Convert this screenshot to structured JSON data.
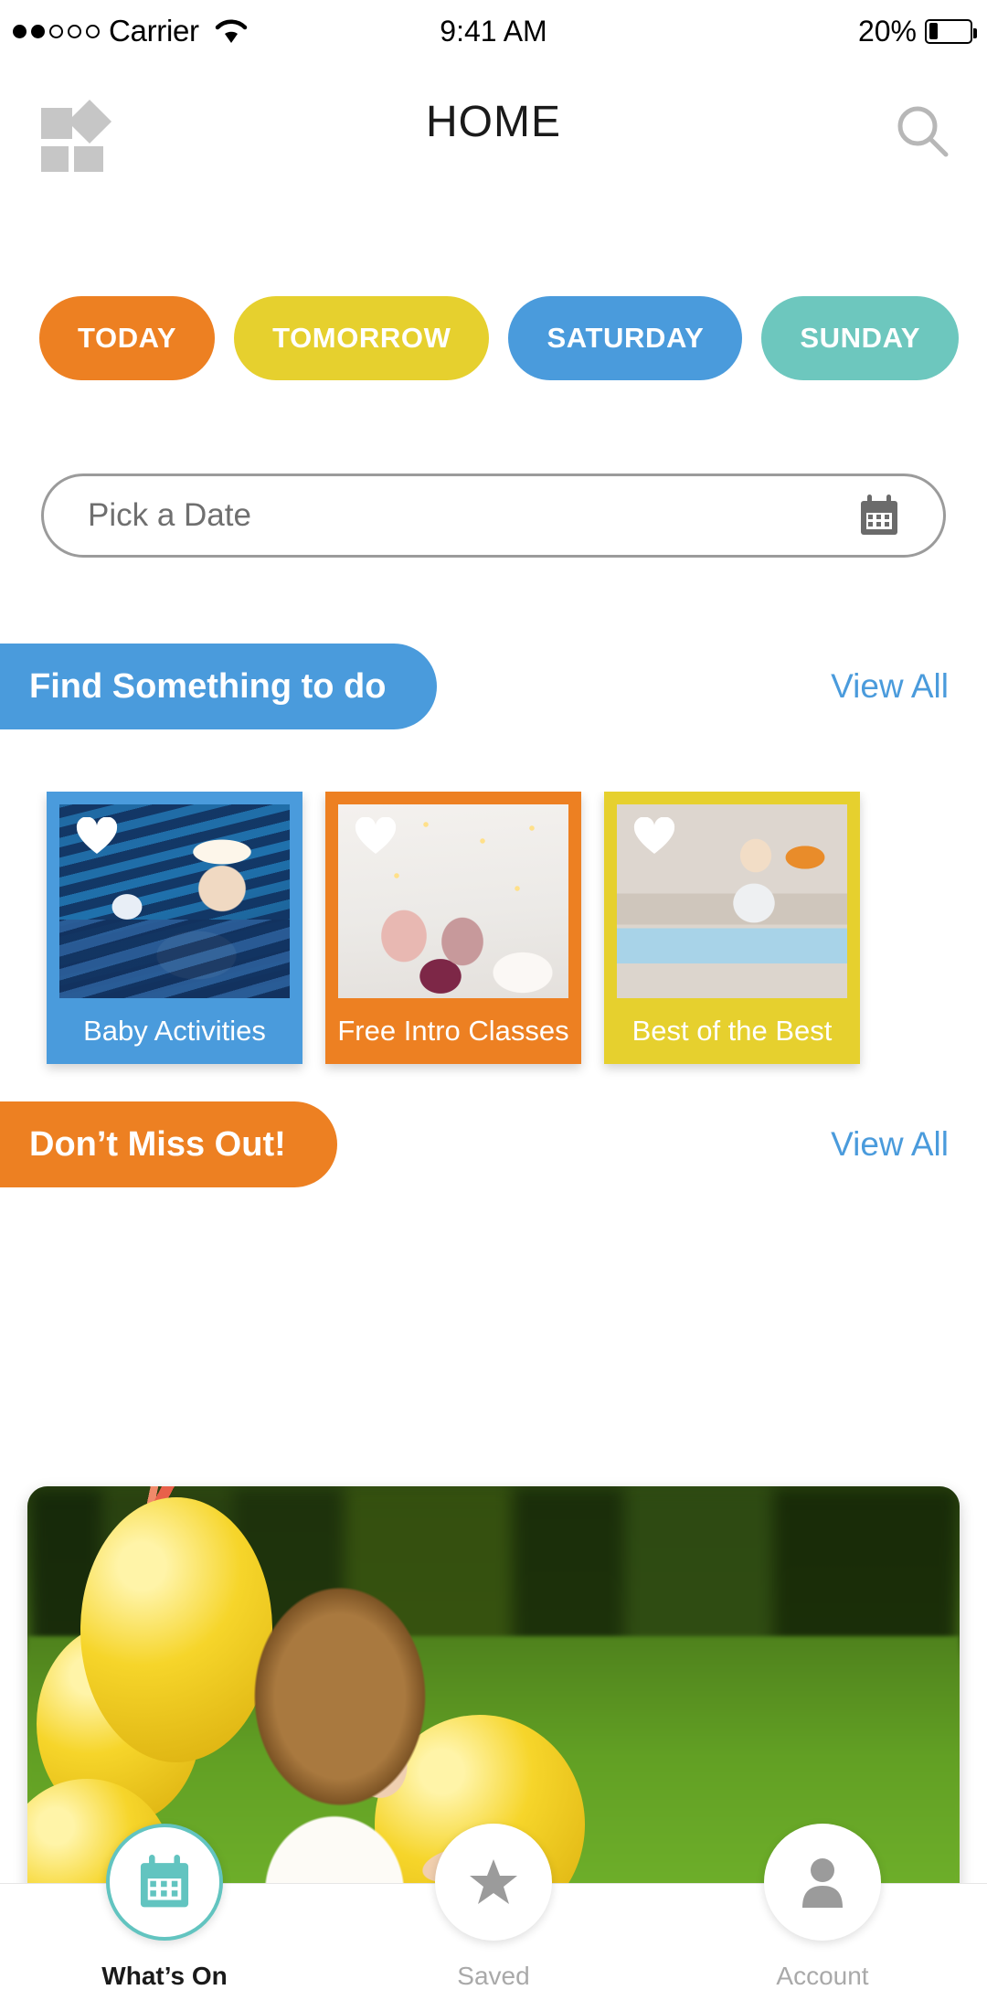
{
  "status_bar": {
    "carrier": "Carrier",
    "signal_filled": 2,
    "signal_total": 5,
    "wifi_icon": "wifi-icon",
    "time": "9:41 AM",
    "battery_percent": "20%",
    "battery_level": 20
  },
  "header": {
    "logo_icon": "blocks-logo-icon",
    "title": "HOME",
    "search_icon": "search-icon"
  },
  "day_chips": [
    {
      "label": "TODAY",
      "color": "#ED8022"
    },
    {
      "label": "TOMORROW",
      "color": "#E6D02E"
    },
    {
      "label": "SATURDAY",
      "color": "#4A9BDC"
    },
    {
      "label": "SUNDAY",
      "color": "#6DC7BE"
    }
  ],
  "date_picker": {
    "placeholder": "Pick a Date",
    "value": "",
    "calendar_icon": "calendar-icon"
  },
  "sections": [
    {
      "title": "Find Something to do",
      "pill_color": "#4A9BDC",
      "view_all_label": "View All",
      "view_all_color": "#4A9BDC"
    },
    {
      "title": "Don’t Miss Out!",
      "pill_color": "#ED8022",
      "view_all_label": "View All",
      "view_all_color": "#4A9BDC"
    }
  ],
  "category_cards": [
    {
      "label": "Baby Activities",
      "color": "#4A9BDC",
      "favorite_icon": "heart-icon",
      "photo": "baby-in-blue-hammock"
    },
    {
      "label": "Free Intro Classes",
      "color": "#ED8022",
      "favorite_icon": "heart-icon",
      "photo": "two-girls-with-teddy-bears"
    },
    {
      "label": "Best of the Best",
      "color": "#E6D02E",
      "favorite_icon": "heart-icon",
      "photo": "toddler-on-blue-rocker"
    }
  ],
  "hero": {
    "photo": "girl-with-yellow-balloons-on-grass"
  },
  "bottom_nav": [
    {
      "label": "What’s On",
      "icon": "calendar-icon",
      "active": true,
      "accent": "#62C4C0"
    },
    {
      "label": "Saved",
      "icon": "star-icon",
      "active": false,
      "accent": "#9B9B9B"
    },
    {
      "label": "Account",
      "icon": "person-icon",
      "active": false,
      "accent": "#9B9B9B"
    }
  ]
}
